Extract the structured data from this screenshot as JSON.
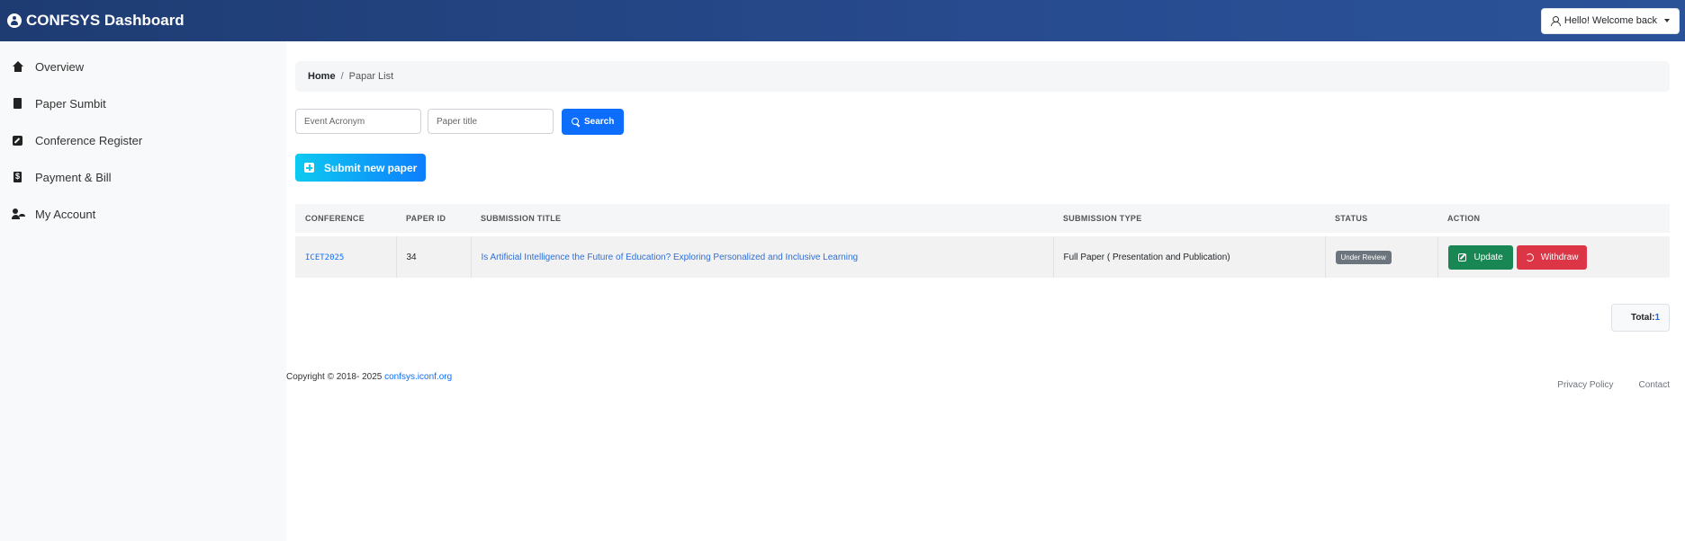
{
  "header": {
    "brand": "CONFSYS Dashboard",
    "user_menu_label": "Hello! Welcome back"
  },
  "sidebar": {
    "items": [
      {
        "label": "Overview",
        "icon": "home-icon"
      },
      {
        "label": "Paper Sumbit",
        "icon": "file-icon"
      },
      {
        "label": "Conference Register",
        "icon": "edit-icon"
      },
      {
        "label": "Payment & Bill",
        "icon": "invoice-icon"
      },
      {
        "label": "My Account",
        "icon": "user-gear-icon"
      }
    ]
  },
  "breadcrumb": {
    "home": "Home",
    "separator": "/",
    "current": "Papar List"
  },
  "filters": {
    "event_placeholder": "Event Acronym",
    "title_placeholder": "Paper title",
    "search_label": "Search"
  },
  "submit_button": "Submit new paper",
  "table": {
    "headers": [
      "CONFERENCE",
      "PAPER ID",
      "SUBMISSION TITLE",
      "SUBMISSION TYPE",
      "STATUS",
      "ACTION"
    ],
    "rows": [
      {
        "conference": "ICET2025",
        "paper_id": "34",
        "title": "Is Artificial Intelligence the Future of Education? Exploring Personalized and Inclusive Learning",
        "type": "Full Paper ( Presentation and Publication)",
        "status": "Under Review",
        "update_label": "Update",
        "withdraw_label": "Withdraw"
      }
    ]
  },
  "total": {
    "label": "Total:",
    "value": "1"
  },
  "footer": {
    "copyright": "Copyright © 2018- 2025 ",
    "link": "confsys.iconf.org",
    "privacy": "Privacy Policy",
    "contact": "Contact"
  },
  "colors": {
    "primary": "#0d6efd",
    "success": "#198754",
    "danger": "#dc3545",
    "header_start": "#1e3c72",
    "header_end": "#2a5298"
  }
}
